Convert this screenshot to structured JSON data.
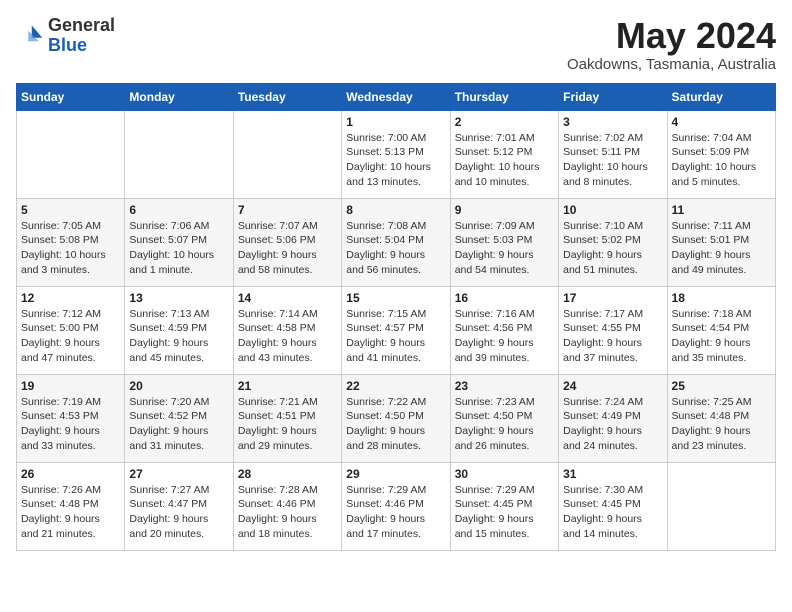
{
  "header": {
    "logo_general": "General",
    "logo_blue": "Blue",
    "month_title": "May 2024",
    "location": "Oakdowns, Tasmania, Australia"
  },
  "days_of_week": [
    "Sunday",
    "Monday",
    "Tuesday",
    "Wednesday",
    "Thursday",
    "Friday",
    "Saturday"
  ],
  "weeks": [
    [
      {
        "day": "",
        "info": ""
      },
      {
        "day": "",
        "info": ""
      },
      {
        "day": "",
        "info": ""
      },
      {
        "day": "1",
        "info": "Sunrise: 7:00 AM\nSunset: 5:13 PM\nDaylight: 10 hours\nand 13 minutes."
      },
      {
        "day": "2",
        "info": "Sunrise: 7:01 AM\nSunset: 5:12 PM\nDaylight: 10 hours\nand 10 minutes."
      },
      {
        "day": "3",
        "info": "Sunrise: 7:02 AM\nSunset: 5:11 PM\nDaylight: 10 hours\nand 8 minutes."
      },
      {
        "day": "4",
        "info": "Sunrise: 7:04 AM\nSunset: 5:09 PM\nDaylight: 10 hours\nand 5 minutes."
      }
    ],
    [
      {
        "day": "5",
        "info": "Sunrise: 7:05 AM\nSunset: 5:08 PM\nDaylight: 10 hours\nand 3 minutes."
      },
      {
        "day": "6",
        "info": "Sunrise: 7:06 AM\nSunset: 5:07 PM\nDaylight: 10 hours\nand 1 minute."
      },
      {
        "day": "7",
        "info": "Sunrise: 7:07 AM\nSunset: 5:06 PM\nDaylight: 9 hours\nand 58 minutes."
      },
      {
        "day": "8",
        "info": "Sunrise: 7:08 AM\nSunset: 5:04 PM\nDaylight: 9 hours\nand 56 minutes."
      },
      {
        "day": "9",
        "info": "Sunrise: 7:09 AM\nSunset: 5:03 PM\nDaylight: 9 hours\nand 54 minutes."
      },
      {
        "day": "10",
        "info": "Sunrise: 7:10 AM\nSunset: 5:02 PM\nDaylight: 9 hours\nand 51 minutes."
      },
      {
        "day": "11",
        "info": "Sunrise: 7:11 AM\nSunset: 5:01 PM\nDaylight: 9 hours\nand 49 minutes."
      }
    ],
    [
      {
        "day": "12",
        "info": "Sunrise: 7:12 AM\nSunset: 5:00 PM\nDaylight: 9 hours\nand 47 minutes."
      },
      {
        "day": "13",
        "info": "Sunrise: 7:13 AM\nSunset: 4:59 PM\nDaylight: 9 hours\nand 45 minutes."
      },
      {
        "day": "14",
        "info": "Sunrise: 7:14 AM\nSunset: 4:58 PM\nDaylight: 9 hours\nand 43 minutes."
      },
      {
        "day": "15",
        "info": "Sunrise: 7:15 AM\nSunset: 4:57 PM\nDaylight: 9 hours\nand 41 minutes."
      },
      {
        "day": "16",
        "info": "Sunrise: 7:16 AM\nSunset: 4:56 PM\nDaylight: 9 hours\nand 39 minutes."
      },
      {
        "day": "17",
        "info": "Sunrise: 7:17 AM\nSunset: 4:55 PM\nDaylight: 9 hours\nand 37 minutes."
      },
      {
        "day": "18",
        "info": "Sunrise: 7:18 AM\nSunset: 4:54 PM\nDaylight: 9 hours\nand 35 minutes."
      }
    ],
    [
      {
        "day": "19",
        "info": "Sunrise: 7:19 AM\nSunset: 4:53 PM\nDaylight: 9 hours\nand 33 minutes."
      },
      {
        "day": "20",
        "info": "Sunrise: 7:20 AM\nSunset: 4:52 PM\nDaylight: 9 hours\nand 31 minutes."
      },
      {
        "day": "21",
        "info": "Sunrise: 7:21 AM\nSunset: 4:51 PM\nDaylight: 9 hours\nand 29 minutes."
      },
      {
        "day": "22",
        "info": "Sunrise: 7:22 AM\nSunset: 4:50 PM\nDaylight: 9 hours\nand 28 minutes."
      },
      {
        "day": "23",
        "info": "Sunrise: 7:23 AM\nSunset: 4:50 PM\nDaylight: 9 hours\nand 26 minutes."
      },
      {
        "day": "24",
        "info": "Sunrise: 7:24 AM\nSunset: 4:49 PM\nDaylight: 9 hours\nand 24 minutes."
      },
      {
        "day": "25",
        "info": "Sunrise: 7:25 AM\nSunset: 4:48 PM\nDaylight: 9 hours\nand 23 minutes."
      }
    ],
    [
      {
        "day": "26",
        "info": "Sunrise: 7:26 AM\nSunset: 4:48 PM\nDaylight: 9 hours\nand 21 minutes."
      },
      {
        "day": "27",
        "info": "Sunrise: 7:27 AM\nSunset: 4:47 PM\nDaylight: 9 hours\nand 20 minutes."
      },
      {
        "day": "28",
        "info": "Sunrise: 7:28 AM\nSunset: 4:46 PM\nDaylight: 9 hours\nand 18 minutes."
      },
      {
        "day": "29",
        "info": "Sunrise: 7:29 AM\nSunset: 4:46 PM\nDaylight: 9 hours\nand 17 minutes."
      },
      {
        "day": "30",
        "info": "Sunrise: 7:29 AM\nSunset: 4:45 PM\nDaylight: 9 hours\nand 15 minutes."
      },
      {
        "day": "31",
        "info": "Sunrise: 7:30 AM\nSunset: 4:45 PM\nDaylight: 9 hours\nand 14 minutes."
      },
      {
        "day": "",
        "info": ""
      }
    ]
  ]
}
